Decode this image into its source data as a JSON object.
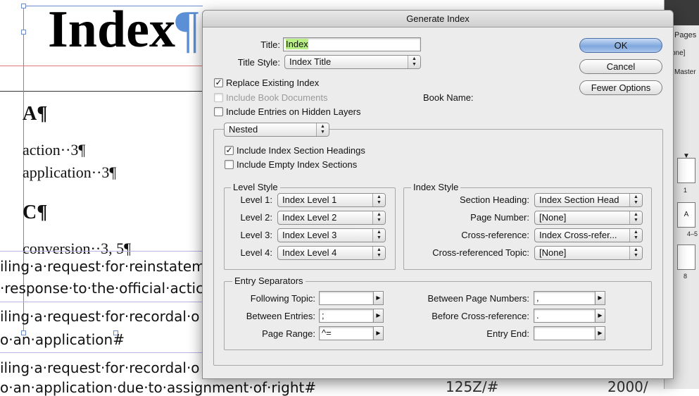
{
  "document": {
    "title": "Index",
    "pilcrow": "¶",
    "letters": [
      "A¶",
      "C¶"
    ],
    "entries": [
      "action··3¶",
      "application··3¶",
      "conversion··3, 5¶"
    ],
    "body_lines": [
      "iling·a·request·for·reinstatem",
      "·response·to·the·official·actic",
      "iling·a·request·for·recordal·o",
      "o·an·application#",
      "iling·a·request·for·recordal·o",
      "o·an·application·due·to·assignment·of·right#"
    ],
    "bottom_right": [
      "125Z/#",
      "2000/"
    ]
  },
  "pages_panel": {
    "tab": "Pages",
    "none_label": "one]",
    "master_label": "Master",
    "thumbs": [
      {
        "label": "",
        "number": "1"
      },
      {
        "label": "A",
        "number": "4–5"
      },
      {
        "label": "",
        "number": "8"
      }
    ]
  },
  "dialog": {
    "title": "Generate Index",
    "title_label": "Title:",
    "title_value": "Index",
    "title_style_label": "Title Style:",
    "title_style_value": "Index Title",
    "replace_existing": {
      "label": "Replace Existing Index",
      "checked": true
    },
    "include_book_docs": {
      "label": "Include Book Documents",
      "checked": false
    },
    "book_name_label": "Book Name:",
    "include_hidden_layers": {
      "label": "Include Entries on Hidden Layers",
      "checked": false
    },
    "format_select": "Nested",
    "include_section_headings": {
      "label": "Include Index Section Headings",
      "checked": true
    },
    "include_empty_sections": {
      "label": "Include Empty Index Sections",
      "checked": false
    },
    "buttons": {
      "ok": "OK",
      "cancel": "Cancel",
      "fewer_options": "Fewer Options"
    },
    "level_style": {
      "title": "Level Style",
      "levels": [
        {
          "label": "Level 1:",
          "value": "Index Level 1"
        },
        {
          "label": "Level 2:",
          "value": "Index Level 2"
        },
        {
          "label": "Level 3:",
          "value": "Index Level 3"
        },
        {
          "label": "Level 4:",
          "value": "Index Level 4"
        }
      ]
    },
    "index_style": {
      "title": "Index Style",
      "rows": [
        {
          "label": "Section Heading:",
          "value": "Index Section Head"
        },
        {
          "label": "Page Number:",
          "value": "[None]"
        },
        {
          "label": "Cross-reference:",
          "value": "Index Cross-refer..."
        },
        {
          "label": "Cross-referenced Topic:",
          "value": "[None]"
        }
      ]
    },
    "entry_separators": {
      "title": "Entry Separators",
      "left": [
        {
          "label": "Following Topic:",
          "value": ""
        },
        {
          "label": "Between Entries:",
          "value": ";"
        },
        {
          "label": "Page Range:",
          "value": "^="
        }
      ],
      "right": [
        {
          "label": "Between Page Numbers:",
          "value": ","
        },
        {
          "label": "Before Cross-reference:",
          "value": "."
        },
        {
          "label": "Entry End:",
          "value": ""
        }
      ]
    }
  }
}
